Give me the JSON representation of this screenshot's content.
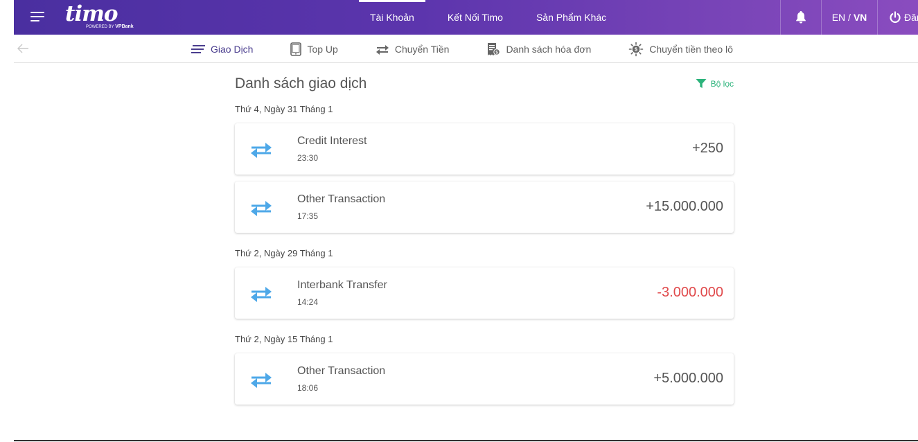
{
  "header": {
    "logo": {
      "word": "timo",
      "powered_by": "POWERED BY",
      "bank": "VPBank"
    },
    "nav": [
      {
        "label": "Tài Khoản",
        "active": true
      },
      {
        "label": "Kết Nối Timo",
        "active": false
      },
      {
        "label": "Sản Phẩm Khác",
        "active": false
      }
    ],
    "lang": {
      "en": "EN",
      "sep": " / ",
      "vn": "VN",
      "selected": "VN"
    },
    "logout_label": "Đăng"
  },
  "subnav": [
    {
      "label": "Giao Dịch",
      "icon": "lines-icon",
      "active": true
    },
    {
      "label": "Top Up",
      "icon": "phone-icon",
      "active": false
    },
    {
      "label": "Chuyển Tiền",
      "icon": "transfer-icon",
      "active": false
    },
    {
      "label": "Danh sách hóa đơn",
      "icon": "bill-icon",
      "active": false
    },
    {
      "label": "Chuyển tiền theo lô",
      "icon": "batch-icon",
      "active": false
    }
  ],
  "main": {
    "title": "Danh sách giao dịch",
    "filter_label": "Bộ lọc",
    "groups": [
      {
        "date": "Thứ 4, Ngày 31 Tháng 1",
        "transactions": [
          {
            "name": "Credit Interest",
            "time": "23:30",
            "amount": "+250",
            "negative": false
          },
          {
            "name": "Other Transaction",
            "time": "17:35",
            "amount": "+15.000.000",
            "negative": false
          }
        ]
      },
      {
        "date": "Thứ 2, Ngày 29 Tháng 1",
        "transactions": [
          {
            "name": "Interbank Transfer",
            "time": "14:24",
            "amount": "-3.000.000",
            "negative": true
          }
        ]
      },
      {
        "date": "Thứ 2, Ngày 15 Tháng 1",
        "transactions": [
          {
            "name": "Other Transaction",
            "time": "18:06",
            "amount": "+5.000.000",
            "negative": false
          }
        ]
      }
    ]
  },
  "colors": {
    "header_start": "#4a2fa0",
    "header_end": "#8a4cbf",
    "accent_green": "#2cb37b",
    "transfer_icon": "#4ea8e8",
    "negative": "#e0494b"
  }
}
